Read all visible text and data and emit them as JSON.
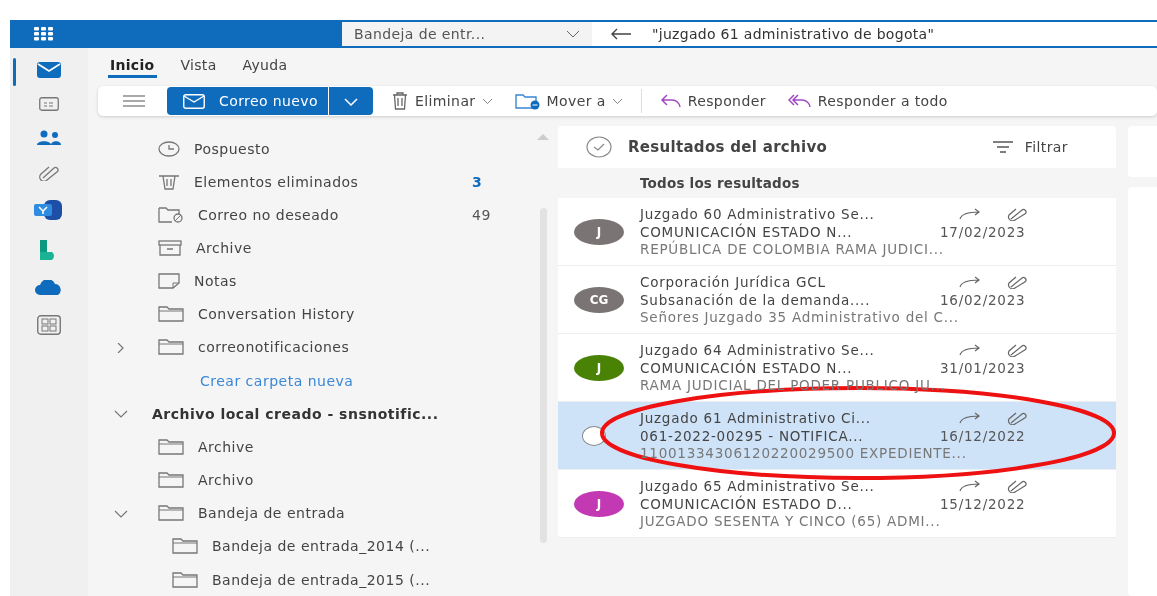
{
  "search": {
    "scope": "Bandeja de entr...",
    "value": "\"juzgado 61 administrativo de bogota\""
  },
  "ribbon_tabs": [
    {
      "label": "Inicio",
      "selected": true
    },
    {
      "label": "Vista",
      "selected": false
    },
    {
      "label": "Ayuda",
      "selected": false
    }
  ],
  "toolbar": {
    "new_mail": "Correo nuevo",
    "actions": [
      "Eliminar",
      "Mover a",
      "Responder",
      "Responder a todo"
    ]
  },
  "folders": [
    {
      "label": "Pospuesto",
      "kind": "folder"
    },
    {
      "label": "Elementos eliminados",
      "kind": "folder",
      "count": "3",
      "count_unread": true
    },
    {
      "label": "Correo no deseado",
      "kind": "folder",
      "count": "49",
      "count_unread": false
    },
    {
      "label": "Archive",
      "kind": "folder"
    },
    {
      "label": "Notas",
      "kind": "folder"
    },
    {
      "label": "Conversation History",
      "kind": "folder"
    },
    {
      "label": "correonotificaciones",
      "kind": "folder",
      "expanded": false
    },
    {
      "label": "Crear carpeta nueva",
      "kind": "link"
    },
    {
      "label": "Archivo local creado - snsnotific...",
      "kind": "account",
      "expanded": true,
      "children": [
        {
          "label": "Archive",
          "kind": "folder"
        },
        {
          "label": "Archivo",
          "kind": "folder"
        },
        {
          "label": "Bandeja de entrada",
          "kind": "folder",
          "expanded": true,
          "children": [
            {
              "label": "Bandeja de entrada_2014 (...",
              "kind": "folder"
            },
            {
              "label": "Bandeja de entrada_2015 (...",
              "kind": "folder"
            }
          ]
        }
      ]
    }
  ],
  "results": {
    "title": "Resultados del archivo",
    "filter": "Filtrar",
    "section": "Todos los resultados",
    "messages": [
      {
        "initials": "J",
        "color": "#7a7574",
        "sender": "Juzgado 60 Administrativo Se...",
        "subject": "COMUNICACIÓN ESTADO N...",
        "date": "17/02/2023",
        "preview": "REPÚBLICA DE COLOMBIA RAMA JUDICI...",
        "selected": false
      },
      {
        "initials": "CG",
        "color": "#7a7574",
        "sender": "Corporación Jurídica GCL",
        "subject": "Subsanación de la demanda....",
        "date": "16/02/2023",
        "preview": "Señores Juzgado 35 Administrativo del C...",
        "selected": false
      },
      {
        "initials": "J",
        "color": "#498205",
        "sender": "Juzgado 64 Administrativo Se...",
        "subject": "COMUNICACIÓN ESTADO N...",
        "date": "31/01/2023",
        "preview": "RAMA JUDICIAL DEL PODER PUBLICO JU...",
        "selected": false
      },
      {
        "sender": "Juzgado 61 Administrativo Ci...",
        "subject": "061-2022-00295 - NOTIFICA...",
        "date": "16/12/2022",
        "preview": "11001334306120220029500 EXPEDIENTE...",
        "selected": true
      },
      {
        "initials": "J",
        "color": "#c239b3",
        "sender": "Juzgado 65 Administrativo Se...",
        "subject": "COMUNICACIÓN ESTADO D...",
        "date": "15/12/2022",
        "preview": "JUZGADO SESENTA Y CINCO (65) ADMI...",
        "selected": false
      }
    ]
  }
}
